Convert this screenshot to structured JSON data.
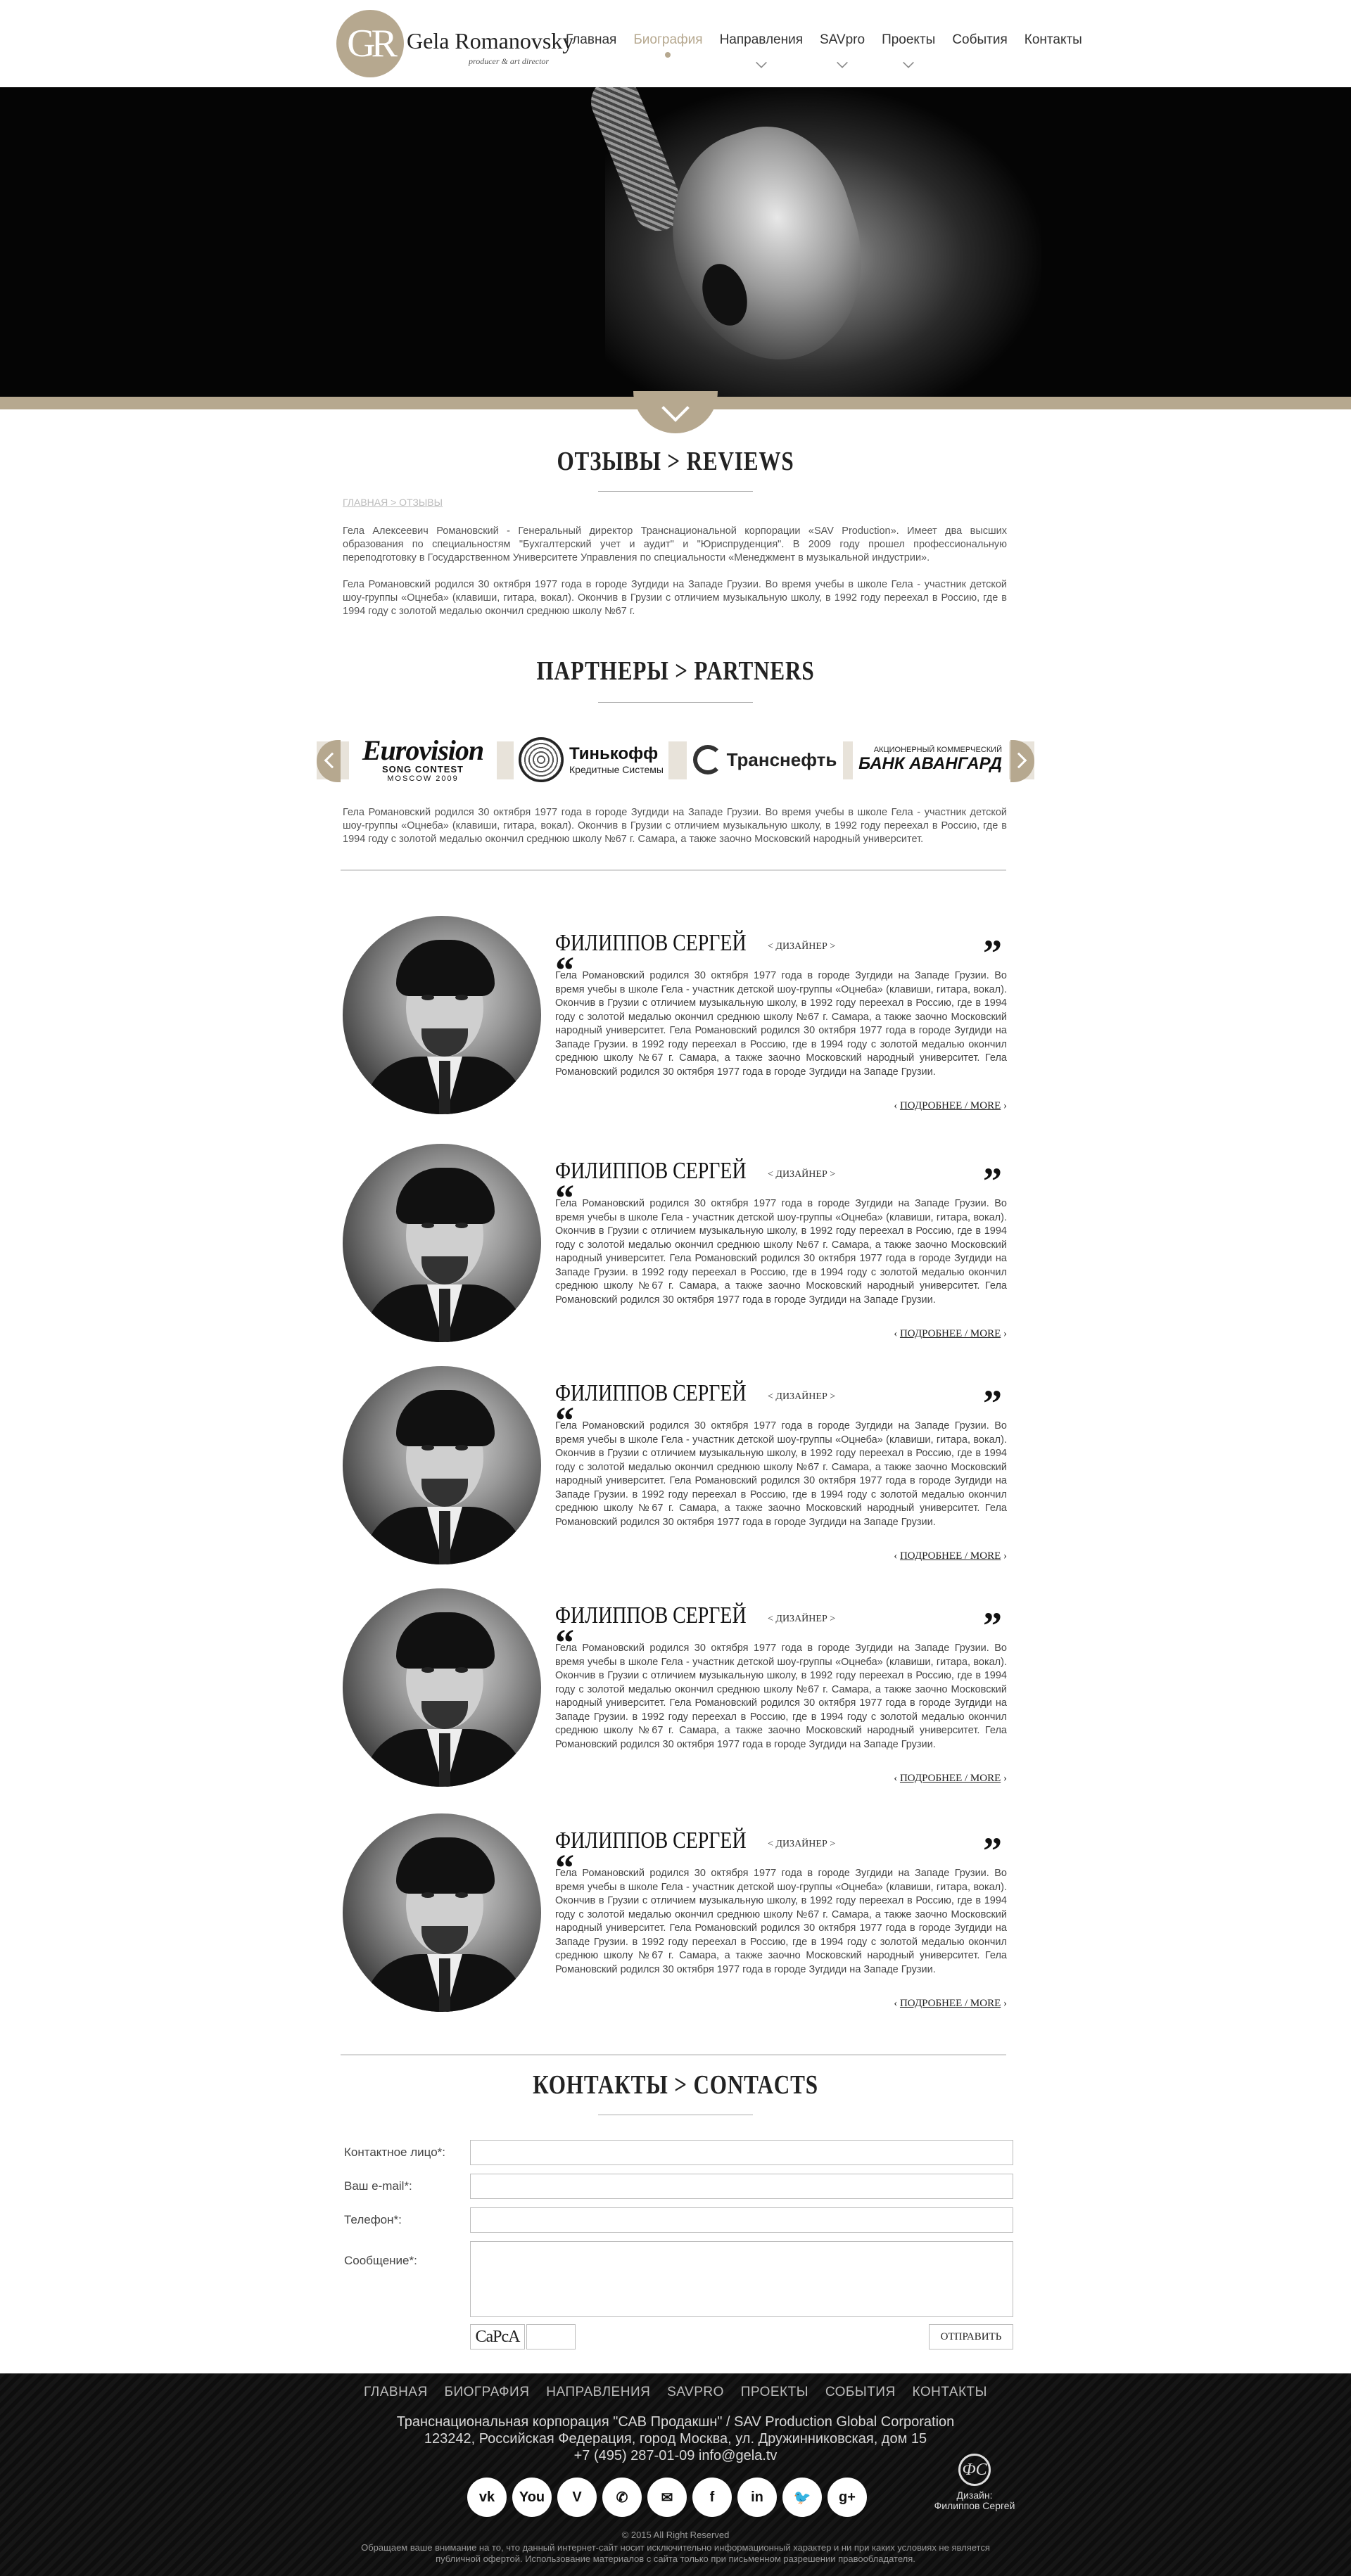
{
  "brand": {
    "monogram": "GR",
    "name": "Gela Romanovsky",
    "subtitle": "producer & art director"
  },
  "nav": [
    {
      "label": "Главная"
    },
    {
      "label": "Биография",
      "active": true
    },
    {
      "label": "Направления",
      "dropdown": true
    },
    {
      "label": "SAVpro",
      "dropdown": true
    },
    {
      "label": "Проекты",
      "dropdown": true
    },
    {
      "label": "События"
    },
    {
      "label": "Контакты"
    }
  ],
  "reviews_section": {
    "title": "ОТЗЫВЫ > REVIEWS",
    "breadcrumb": "ГЛАВНАЯ > ОТЗЫВЫ",
    "para1": "Гела Алексеевич Романовский - Генеральный директор Транснациональной корпорации «SAV Production». Имеет два высших образования по специальностям \"Бухгалтерский учет и аудит\" и \"Юриспруденция\". В 2009 году прошел профессиональную переподготовку в Государственном Университете Управления по специальности «Менеджмент в музыкальной индустрии».",
    "para2": "Гела Романовский родился 30 октября 1977 года в городе Зугдиди на Западе Грузии. Во время учебы в школе Гела - участник детской шоу-группы «Оцнеба» (клавиши, гитара, вокал). Окончив в Грузии с отличием музыкальную школу, в 1992 году переехал в Россию, где в 1994 году с золотой медалью окончил среднюю школу №67 г."
  },
  "partners_section": {
    "title": "ПАРТНЕРЫ > PARTNERS",
    "partners": [
      {
        "name": "Eurovision",
        "line1": "SONG CONTEST",
        "line2": "MOSCOW 2009"
      },
      {
        "name": "Тинькофф",
        "sub": "Кредитные Системы"
      },
      {
        "name": "Транснефть"
      },
      {
        "name": "БАНК АВАНГАРД",
        "sub": "АКЦИОНЕРНЫЙ КОММЕРЧЕСКИЙ"
      }
    ],
    "text": "Гела Романовский родился 30 октября 1977 года в городе Зугдиди на Западе Грузии. Во время учебы в школе Гела - участник детской шоу-группы «Оцнеба» (клавиши, гитара, вокал). Окончив в Грузии с отличием музыкальную школу, в 1992 году переехал в Россию, где в 1994 году с золотой медалью окончил среднюю школу №67 г. Самара, а также заочно Московский народный университет."
  },
  "reviews": [
    {
      "name": "ФИЛИППОВ СЕРГЕЙ",
      "role": "< ДИЗАЙНЕР >",
      "text": "Гела Романовский родился 30 октября 1977 года в городе Зугдиди на Западе Грузии. Во время учебы в школе Гела - участник детской шоу-группы «Оцнеба» (клавиши, гитара, вокал). Окончив в Грузии с отличием музыкальную школу, в 1992 году переехал в Россию, где в 1994 году с золотой медалью окончил среднюю школу №67 г. Самара, а также заочно Московский народный университет. Гела Романовский родился 30 октября 1977 года в городе Зугдиди на Западе Грузии. в 1992 году переехал в Россию, где в 1994 году с золотой медалью окончил среднюю школу №67 г. Самара, а также заочно Московский народный университет. Гела Романовский родился 30 октября 1977 года в городе Зугдиди на Западе Грузии.",
      "more": "ПОДРОБНЕЕ / MORE"
    },
    {
      "name": "ФИЛИППОВ СЕРГЕЙ",
      "role": "< ДИЗАЙНЕР >",
      "text": "Гела Романовский родился 30 октября 1977 года в городе Зугдиди на Западе Грузии. Во время учебы в школе Гела - участник детской шоу-группы «Оцнеба» (клавиши, гитара, вокал). Окончив в Грузии с отличием музыкальную школу, в 1992 году переехал в Россию, где в 1994 году с золотой медалью окончил среднюю школу №67 г. Самара, а также заочно Московский народный университет. Гела Романовский родился 30 октября 1977 года в городе Зугдиди на Западе Грузии. в 1992 году переехал в Россию, где в 1994 году с золотой медалью окончил среднюю школу №67 г. Самара, а также заочно Московский народный университет. Гела Романовский родился 30 октября 1977 года в городе Зугдиди на Западе Грузии.",
      "more": "ПОДРОБНЕЕ / MORE"
    },
    {
      "name": "ФИЛИППОВ СЕРГЕЙ",
      "role": "< ДИЗАЙНЕР >",
      "text": "Гела Романовский родился 30 октября 1977 года в городе Зугдиди на Западе Грузии. Во время учебы в школе Гела - участник детской шоу-группы «Оцнеба» (клавиши, гитара, вокал). Окончив в Грузии с отличием музыкальную школу, в 1992 году переехал в Россию, где в 1994 году с золотой медалью окончил среднюю школу №67 г. Самара, а также заочно Московский народный университет. Гела Романовский родился 30 октября 1977 года в городе Зугдиди на Западе Грузии. в 1992 году переехал в Россию, где в 1994 году с золотой медалью окончил среднюю школу №67 г. Самара, а также заочно Московский народный университет. Гела Романовский родился 30 октября 1977 года в городе Зугдиди на Западе Грузии.",
      "more": "ПОДРОБНЕЕ / MORE"
    },
    {
      "name": "ФИЛИППОВ СЕРГЕЙ",
      "role": "< ДИЗАЙНЕР >",
      "text": "Гела Романовский родился 30 октября 1977 года в городе Зугдиди на Западе Грузии. Во время учебы в школе Гела - участник детской шоу-группы «Оцнеба» (клавиши, гитара, вокал). Окончив в Грузии с отличием музыкальную школу, в 1992 году переехал в Россию, где в 1994 году с золотой медалью окончил среднюю школу №67 г. Самара, а также заочно Московский народный университет. Гела Романовский родился 30 октября 1977 года в городе Зугдиди на Западе Грузии. в 1992 году переехал в Россию, где в 1994 году с золотой медалью окончил среднюю школу №67 г. Самара, а также заочно Московский народный университет. Гела Романовский родился 30 октября 1977 года в городе Зугдиди на Западе Грузии.",
      "more": "ПОДРОБНЕЕ / MORE"
    },
    {
      "name": "ФИЛИППОВ СЕРГЕЙ",
      "role": "< ДИЗАЙНЕР >",
      "text": "Гела Романовский родился 30 октября 1977 года в городе Зугдиди на Западе Грузии. Во время учебы в школе Гела - участник детской шоу-группы «Оцнеба» (клавиши, гитара, вокал). Окончив в Грузии с отличием музыкальную школу, в 1992 году переехал в Россию, где в 1994 году с золотой медалью окончил среднюю школу №67 г. Самара, а также заочно Московский народный университет. Гела Романовский родился 30 октября 1977 года в городе Зугдиди на Западе Грузии. в 1992 году переехал в Россию, где в 1994 году с золотой медалью окончил среднюю школу №67 г. Самара, а также заочно Московский народный университет. Гела Романовский родился 30 октября 1977 года в городе Зугдиди на Западе Грузии.",
      "more": "ПОДРОБНЕЕ / MORE"
    }
  ],
  "contacts": {
    "title": "КОНТАКТЫ > CONTACTS",
    "label_name": "Контактное лицо*:",
    "label_email": "Ваш e-mail*:",
    "label_phone": "Телефон*:",
    "label_message": "Сообщение*:",
    "captcha": "CaPcA",
    "send": "ОТПРАВИТЬ"
  },
  "footer": {
    "nav": [
      "ГЛАВНАЯ",
      "БИОГРАФИЯ",
      "НАПРАВЛЕНИЯ",
      "SAVPRO",
      "ПРОЕКТЫ",
      "СОБЫТИЯ",
      "КОНТАКТЫ"
    ],
    "line1": "Транснациональная корпорация \"САВ Продакшн\" / SAV Production Global Corporation",
    "line2": "123242, Российская Федерация, город Москва, ул. Дружинниковская, дом 15",
    "line3": "+7 (495) 287-01-09 info@gela.tv",
    "socials": [
      "vk-icon",
      "youtube-icon",
      "vimeo-icon",
      "phone-icon",
      "mail-icon",
      "facebook-icon",
      "linkedin-icon",
      "twitter-icon",
      "googleplus-icon"
    ],
    "social_glyphs": [
      "vk",
      "You",
      "V",
      "✆",
      "✉",
      "f",
      "in",
      "🐦",
      "g+"
    ],
    "designer_logo": "ФС",
    "designer_label": "Дизайн:",
    "designer_name": "Филиппов Сергей",
    "copyright": "© 2015 All Right Reserved",
    "disclaimer1": "Обращаем ваше внимание на то, что данный интернет-сайт носит исключительно информационный характер и ни при каких условиях не является",
    "disclaimer2": "публичной офертой. Использование материалов с сайта только при письменном разрешении правообладателя."
  },
  "colors": {
    "accent": "#b6a88f",
    "footer_bg": "#121212"
  }
}
